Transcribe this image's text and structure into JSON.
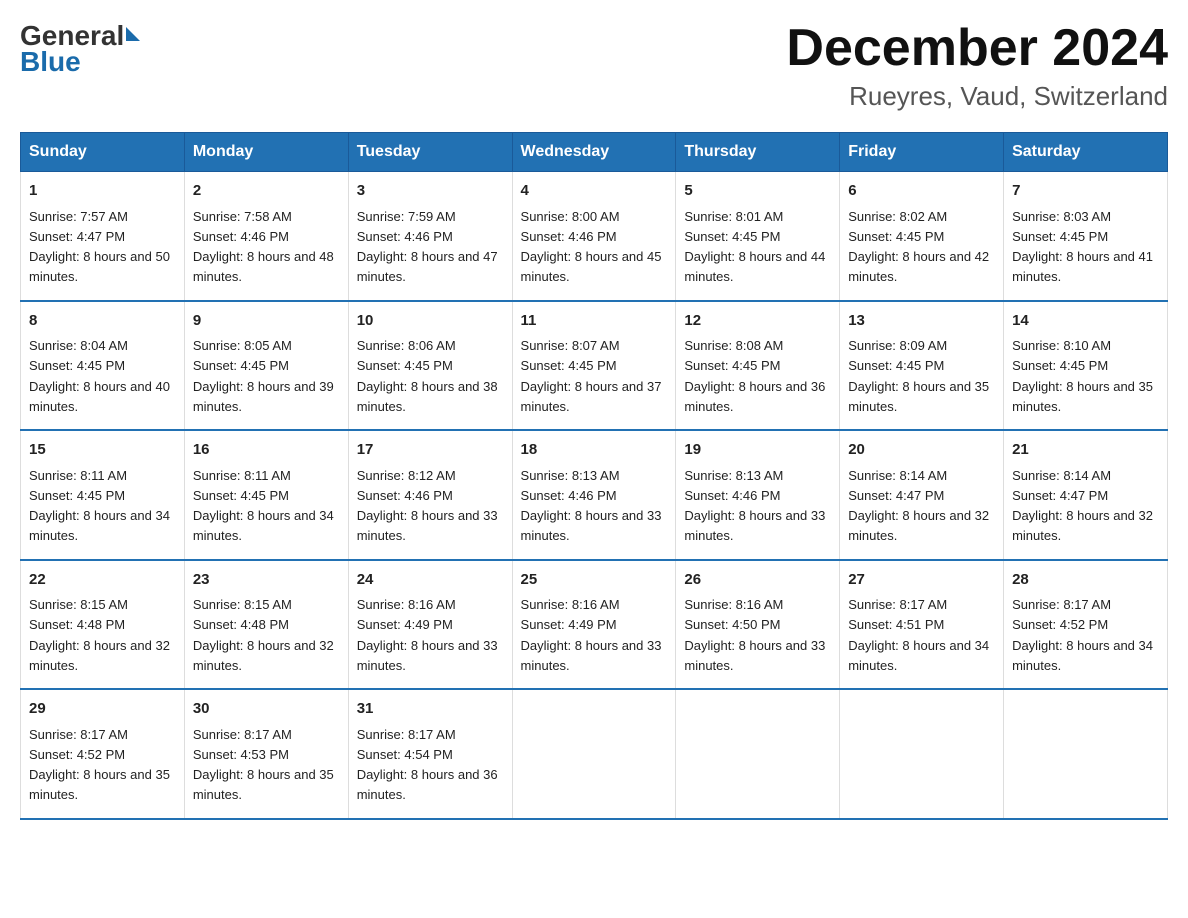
{
  "logo": {
    "general": "General",
    "blue": "Blue"
  },
  "title": "December 2024",
  "subtitle": "Rueyres, Vaud, Switzerland",
  "days_of_week": [
    "Sunday",
    "Monday",
    "Tuesday",
    "Wednesday",
    "Thursday",
    "Friday",
    "Saturday"
  ],
  "weeks": [
    [
      {
        "day": "1",
        "sunrise": "7:57 AM",
        "sunset": "4:47 PM",
        "daylight": "8 hours and 50 minutes."
      },
      {
        "day": "2",
        "sunrise": "7:58 AM",
        "sunset": "4:46 PM",
        "daylight": "8 hours and 48 minutes."
      },
      {
        "day": "3",
        "sunrise": "7:59 AM",
        "sunset": "4:46 PM",
        "daylight": "8 hours and 47 minutes."
      },
      {
        "day": "4",
        "sunrise": "8:00 AM",
        "sunset": "4:46 PM",
        "daylight": "8 hours and 45 minutes."
      },
      {
        "day": "5",
        "sunrise": "8:01 AM",
        "sunset": "4:45 PM",
        "daylight": "8 hours and 44 minutes."
      },
      {
        "day": "6",
        "sunrise": "8:02 AM",
        "sunset": "4:45 PM",
        "daylight": "8 hours and 42 minutes."
      },
      {
        "day": "7",
        "sunrise": "8:03 AM",
        "sunset": "4:45 PM",
        "daylight": "8 hours and 41 minutes."
      }
    ],
    [
      {
        "day": "8",
        "sunrise": "8:04 AM",
        "sunset": "4:45 PM",
        "daylight": "8 hours and 40 minutes."
      },
      {
        "day": "9",
        "sunrise": "8:05 AM",
        "sunset": "4:45 PM",
        "daylight": "8 hours and 39 minutes."
      },
      {
        "day": "10",
        "sunrise": "8:06 AM",
        "sunset": "4:45 PM",
        "daylight": "8 hours and 38 minutes."
      },
      {
        "day": "11",
        "sunrise": "8:07 AM",
        "sunset": "4:45 PM",
        "daylight": "8 hours and 37 minutes."
      },
      {
        "day": "12",
        "sunrise": "8:08 AM",
        "sunset": "4:45 PM",
        "daylight": "8 hours and 36 minutes."
      },
      {
        "day": "13",
        "sunrise": "8:09 AM",
        "sunset": "4:45 PM",
        "daylight": "8 hours and 35 minutes."
      },
      {
        "day": "14",
        "sunrise": "8:10 AM",
        "sunset": "4:45 PM",
        "daylight": "8 hours and 35 minutes."
      }
    ],
    [
      {
        "day": "15",
        "sunrise": "8:11 AM",
        "sunset": "4:45 PM",
        "daylight": "8 hours and 34 minutes."
      },
      {
        "day": "16",
        "sunrise": "8:11 AM",
        "sunset": "4:45 PM",
        "daylight": "8 hours and 34 minutes."
      },
      {
        "day": "17",
        "sunrise": "8:12 AM",
        "sunset": "4:46 PM",
        "daylight": "8 hours and 33 minutes."
      },
      {
        "day": "18",
        "sunrise": "8:13 AM",
        "sunset": "4:46 PM",
        "daylight": "8 hours and 33 minutes."
      },
      {
        "day": "19",
        "sunrise": "8:13 AM",
        "sunset": "4:46 PM",
        "daylight": "8 hours and 33 minutes."
      },
      {
        "day": "20",
        "sunrise": "8:14 AM",
        "sunset": "4:47 PM",
        "daylight": "8 hours and 32 minutes."
      },
      {
        "day": "21",
        "sunrise": "8:14 AM",
        "sunset": "4:47 PM",
        "daylight": "8 hours and 32 minutes."
      }
    ],
    [
      {
        "day": "22",
        "sunrise": "8:15 AM",
        "sunset": "4:48 PM",
        "daylight": "8 hours and 32 minutes."
      },
      {
        "day": "23",
        "sunrise": "8:15 AM",
        "sunset": "4:48 PM",
        "daylight": "8 hours and 32 minutes."
      },
      {
        "day": "24",
        "sunrise": "8:16 AM",
        "sunset": "4:49 PM",
        "daylight": "8 hours and 33 minutes."
      },
      {
        "day": "25",
        "sunrise": "8:16 AM",
        "sunset": "4:49 PM",
        "daylight": "8 hours and 33 minutes."
      },
      {
        "day": "26",
        "sunrise": "8:16 AM",
        "sunset": "4:50 PM",
        "daylight": "8 hours and 33 minutes."
      },
      {
        "day": "27",
        "sunrise": "8:17 AM",
        "sunset": "4:51 PM",
        "daylight": "8 hours and 34 minutes."
      },
      {
        "day": "28",
        "sunrise": "8:17 AM",
        "sunset": "4:52 PM",
        "daylight": "8 hours and 34 minutes."
      }
    ],
    [
      {
        "day": "29",
        "sunrise": "8:17 AM",
        "sunset": "4:52 PM",
        "daylight": "8 hours and 35 minutes."
      },
      {
        "day": "30",
        "sunrise": "8:17 AM",
        "sunset": "4:53 PM",
        "daylight": "8 hours and 35 minutes."
      },
      {
        "day": "31",
        "sunrise": "8:17 AM",
        "sunset": "4:54 PM",
        "daylight": "8 hours and 36 minutes."
      },
      null,
      null,
      null,
      null
    ]
  ]
}
